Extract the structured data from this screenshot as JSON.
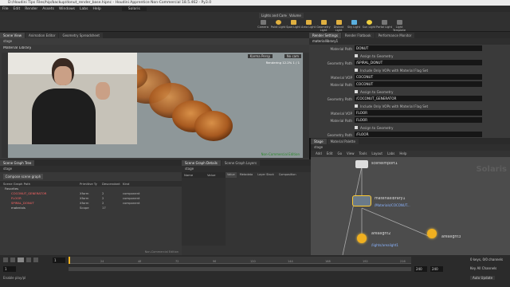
{
  "window": {
    "title": "D:/Houdini Tips Files/hip/backup/donut_render_base.hipnc - Houdini Apprentice Non-Commercial 18.5.462 - Py3.0"
  },
  "menu": [
    "File",
    "Edit",
    "Render",
    "Assets",
    "Windows",
    "Labs",
    "Help"
  ],
  "desktop": "Solaris",
  "shelf_tabs": [
    "Lights and Cameras",
    "Volume"
  ],
  "shelf_tools": [
    "Camera",
    "Point Light",
    "Spot Light",
    "Area Light",
    "Geometry Light",
    "Distant Light",
    "Sky Light",
    "Sun Light",
    "Portal Light",
    "Light Template"
  ],
  "pane_tabs_left": [
    "Scene View",
    "Animation Editor",
    "Geometry Spreadsheet"
  ],
  "pane_tabs_right": [
    "Render Settings",
    "Render Flatbook",
    "Performance Monitor"
  ],
  "viewport": {
    "path": "stage",
    "label": "Material Library",
    "camera_menu": "Karma Persp",
    "view_menu": "No cam",
    "stats": "Rendering   12.2%   1 / 1",
    "watermark": "Non-Commercial Edition"
  },
  "params": {
    "node": "materiallibrary1",
    "rows": [
      {
        "label": "Material Path",
        "value": "DONUT"
      },
      {
        "label": "",
        "value": "Assign to Geometry"
      },
      {
        "label": "Geometry Path",
        "value": "/SPIRAL_DONUT"
      },
      {
        "label": "",
        "value": "Include Only VOPs with Material Flag Set"
      },
      {
        "label": "Material VOP",
        "value": "COCONUT"
      },
      {
        "label": "Material Path",
        "value": "COCONUT"
      },
      {
        "label": "",
        "value": "Assign to Geometry"
      },
      {
        "label": "Geometry Path",
        "value": "/COCONUT_GENERATOR"
      },
      {
        "label": "",
        "value": "Include Only VOPs with Material Flag Set"
      },
      {
        "label": "Material VOP",
        "value": "FLOOR"
      },
      {
        "label": "Material Path",
        "value": "FLOOR"
      },
      {
        "label": "",
        "value": "Assign to Geometry"
      },
      {
        "label": "Geometry Path",
        "value": "/FLOOR"
      }
    ]
  },
  "scene_graph": {
    "tabs": [
      "Scene Graph Tree",
      "Scene Graph Details",
      "Scene Graph Layers"
    ],
    "path": "stage",
    "button": "Compose scene graph",
    "columns": [
      "Scene Graph Path",
      "Primitive Ty",
      "Descendant",
      "Kind"
    ],
    "rows": [
      {
        "name": "Favorites",
        "type": "",
        "desc": "",
        "kind": "",
        "color": "#ccc"
      },
      {
        "name": "COCONUT_GENERATOR",
        "type": "Xform",
        "desc": "2",
        "kind": "component",
        "color": "#ff6666"
      },
      {
        "name": "FLOOR",
        "type": "Xform",
        "desc": "2",
        "kind": "component",
        "color": "#ff6666"
      },
      {
        "name": "SPIRAL_DONUT",
        "type": "Xform",
        "desc": "2",
        "kind": "component",
        "color": "#ff6666"
      },
      {
        "name": "materials",
        "type": "Scope",
        "desc": "17",
        "kind": "",
        "color": "#ccc"
      }
    ],
    "value_tabs": [
      "Name",
      "Value"
    ],
    "detail_tabs": [
      "Value",
      "Metadata",
      "Layer Stack",
      "Composition"
    ]
  },
  "network": {
    "tabs": [
      "Stage",
      "Material Palette"
    ],
    "path": "stage",
    "menu": [
      "Add",
      "Edit",
      "Go",
      "View",
      "Tools",
      "Layout",
      "Labs",
      "Help"
    ],
    "context_label": "Solaris",
    "watermark": "Non-Commercial Edition",
    "nodes": [
      {
        "name": "sceneimport1",
        "sub": ""
      },
      {
        "name": "materiallibrary1",
        "sub": "/Materials/COCONUT..."
      },
      {
        "name": "arealight1",
        "sub": "/lights/arealight1"
      },
      {
        "name": "arealight2",
        "sub": ""
      },
      {
        "name": "arealight3",
        "sub": "/lights/arealight3"
      }
    ]
  },
  "timeline": {
    "frame": "1",
    "start": "1",
    "end": "240",
    "end2": "240",
    "ticks": [
      "24",
      "48",
      "72",
      "96",
      "120",
      "144",
      "168",
      "192",
      "216"
    ],
    "keys_label": "0 keys, 0/0 channels",
    "key_all": "Key All Channels",
    "auto_update": "Auto Update",
    "status": "Enable play/pl"
  },
  "colors": {
    "accent": "#f0b020",
    "viewport_bg": "#8e9799",
    "selection": "#ffcc33"
  }
}
